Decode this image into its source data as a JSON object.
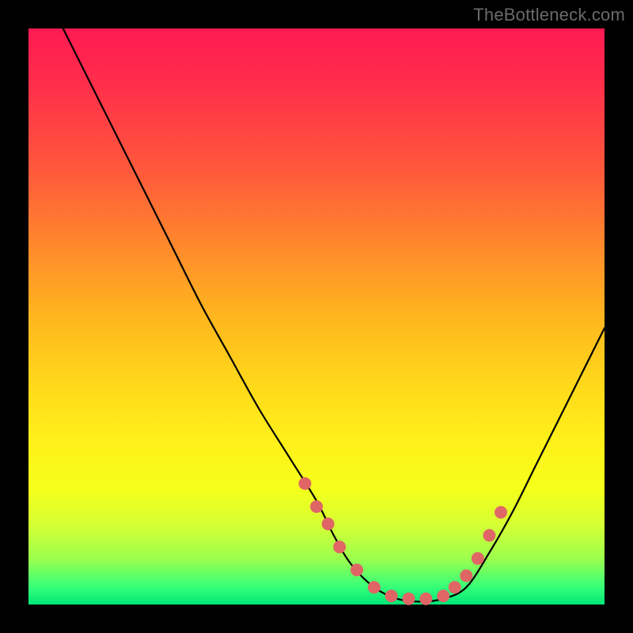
{
  "watermark": "TheBottleneck.com",
  "chart_data": {
    "type": "line",
    "title": "",
    "xlabel": "",
    "ylabel": "",
    "xlim": [
      0,
      100
    ],
    "ylim": [
      0,
      100
    ],
    "curve": {
      "x": [
        6,
        10,
        15,
        20,
        25,
        30,
        35,
        40,
        45,
        50,
        53,
        56,
        60,
        64,
        68,
        72,
        76,
        80,
        84,
        88,
        92,
        96,
        100
      ],
      "y": [
        100,
        92,
        82,
        72,
        62,
        52,
        43,
        34,
        26,
        18,
        12,
        7,
        3,
        1,
        0.5,
        1,
        3,
        9,
        16,
        24,
        32,
        40,
        48
      ]
    },
    "marker_series": {
      "name": "highlighted-points",
      "color": "#e06666",
      "x": [
        48,
        50,
        52,
        54,
        57,
        60,
        63,
        66,
        69,
        72,
        74,
        76,
        78,
        80,
        82
      ],
      "y": [
        21,
        17,
        14,
        10,
        6,
        3,
        1.5,
        1,
        1,
        1.5,
        3,
        5,
        8,
        12,
        16
      ]
    },
    "gradient_stops": [
      {
        "pos": 0,
        "color": "#ff1a52"
      },
      {
        "pos": 25,
        "color": "#ff5a3b"
      },
      {
        "pos": 50,
        "color": "#ffb61e"
      },
      {
        "pos": 72,
        "color": "#fff11a"
      },
      {
        "pos": 92,
        "color": "#9cff4d"
      },
      {
        "pos": 100,
        "color": "#00e676"
      }
    ]
  }
}
